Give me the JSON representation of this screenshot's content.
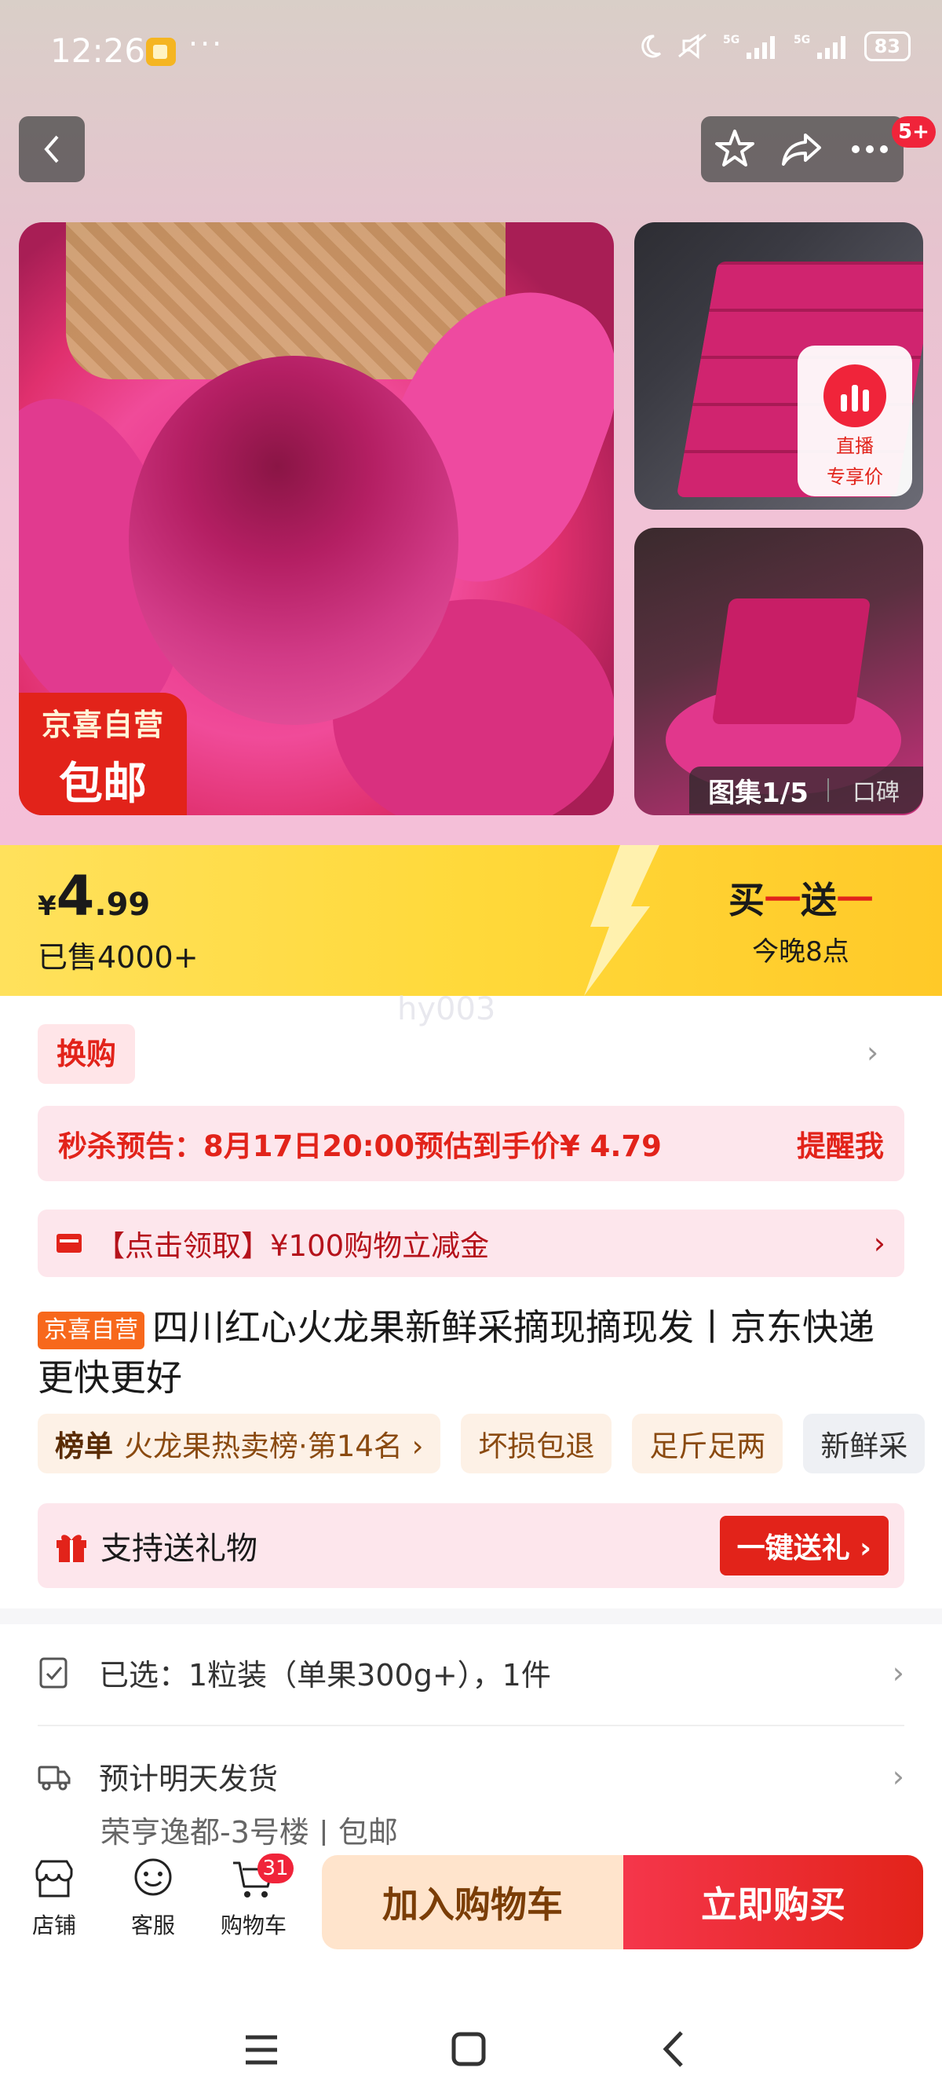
{
  "status_bar": {
    "time": "12:26",
    "more": "···",
    "battery": "83"
  },
  "header": {
    "badge": "5+"
  },
  "gallery": {
    "self_badge_line1": "京喜自营",
    "self_badge_line2": "包邮",
    "live_line1": "直播",
    "live_line2": "专享价",
    "counter": "图集1/5",
    "reviews_tab": "口碑"
  },
  "price_band": {
    "currency": "¥",
    "price_int": "4",
    "price_dec": ".99",
    "sold": "已售4000+",
    "promo_buy": "买",
    "promo_dash": "一",
    "promo_give": "送",
    "promo_time": "今晚8点",
    "watermark": "hy003"
  },
  "swap": {
    "label": "换购"
  },
  "seckill": {
    "text": "秒杀预告：8月17日20:00预估到手价¥ 4.79",
    "remind": "提醒我"
  },
  "coupon": {
    "text": "【点击领取】¥100购物立减金"
  },
  "product": {
    "tag": "京喜自营",
    "title": "四川红心火龙果新鲜采摘现摘现发丨京东快递 更快更好"
  },
  "chips": [
    {
      "rank": "榜单",
      "label": "火龙果热卖榜·第14名 ›"
    },
    {
      "label": "坏损包退"
    },
    {
      "label": "足斤足两"
    },
    {
      "label": "新鲜采"
    }
  ],
  "gift": {
    "label": "支持送礼物",
    "button": "一键送礼 ›"
  },
  "selected": {
    "text": "已选：1粒装（单果300g+），1件"
  },
  "shipping": {
    "text": "预计明天发货",
    "address": "荣亨逸都-3号楼 | 包邮"
  },
  "bottom_bar": {
    "shop": "店铺",
    "service": "客服",
    "cart": "购物车",
    "cart_count": "31",
    "add_to_cart": "加入购物车",
    "buy_now": "立即购买"
  },
  "colors": {
    "brand_red": "#e2231a",
    "price_band": "#ffd93a",
    "light_pink": "#fde6ec",
    "cart_btn": "#ffe4cc"
  }
}
